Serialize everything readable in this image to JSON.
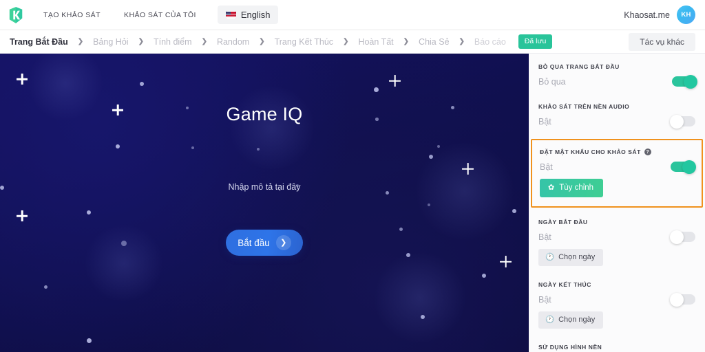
{
  "topbar": {
    "logo_alt": "khaosat-logo",
    "nav": [
      {
        "label": "TẠO KHẢO SÁT",
        "name": "nav-create-survey"
      },
      {
        "label": "KHẢO SÁT CỦA TÔI",
        "name": "nav-my-surveys"
      }
    ],
    "language": {
      "label": "English",
      "flag": "us-flag-icon"
    },
    "user": {
      "name": "Khaosat.me",
      "initials": "KH"
    }
  },
  "breadcrumb": {
    "items": [
      {
        "label": "Trang Bắt Đầu",
        "state": "active"
      },
      {
        "label": "Bảng Hỏi",
        "state": "inactive"
      },
      {
        "label": "Tính điểm",
        "state": "inactive"
      },
      {
        "label": "Random",
        "state": "inactive"
      },
      {
        "label": "Trang Kết Thúc",
        "state": "inactive"
      },
      {
        "label": "Hoàn Tất",
        "state": "inactive"
      },
      {
        "label": "Chia Sẻ",
        "state": "inactive"
      },
      {
        "label": "Báo cáo",
        "state": "dim"
      }
    ],
    "separator": "❯",
    "saved_badge": "Đã lưu",
    "more_actions": "Tác vụ khác"
  },
  "canvas": {
    "title": "Game IQ",
    "description": "Nhập mô tả tại đây",
    "start_button": "Bắt đầu",
    "start_chevron": "❯",
    "background_color": "#10104f"
  },
  "panel": {
    "sections": [
      {
        "name": "skip-start-page",
        "label": "BỎ QUA TRANG BẮT ĐẦU",
        "value": "Bỏ qua",
        "toggle": "on",
        "has_help": false,
        "highlighted": false,
        "button": null
      },
      {
        "name": "audio-background-survey",
        "label": "KHẢO SÁT TRÊN NỀN AUDIO",
        "value": "Bật",
        "toggle": "off",
        "has_help": false,
        "highlighted": false,
        "button": null
      },
      {
        "name": "survey-password",
        "label": "ĐẶT MẬT KHẨU CHO KHẢO SÁT",
        "value": "Bật",
        "toggle": "on",
        "has_help": true,
        "help_glyph": "?",
        "highlighted": true,
        "button": {
          "label": "Tùy chỉnh",
          "icon": "gear-icon",
          "glyph": "✿",
          "style": "green"
        }
      },
      {
        "name": "start-date",
        "label": "NGÀY BẮT ĐẦU",
        "value": "Bật",
        "toggle": "off",
        "has_help": false,
        "highlighted": false,
        "button": {
          "label": "Chọn ngày",
          "icon": "clock-icon",
          "glyph": "🕐",
          "style": "grey"
        }
      },
      {
        "name": "end-date",
        "label": "NGÀY KẾT THÚC",
        "value": "Bật",
        "toggle": "off",
        "has_help": false,
        "highlighted": false,
        "button": {
          "label": "Chọn ngày",
          "icon": "clock-icon",
          "glyph": "🕐",
          "style": "grey"
        }
      },
      {
        "name": "use-background-image",
        "label": "SỬ DỤNG HÌNH NỀN",
        "value": null,
        "toggle": null,
        "has_help": false,
        "highlighted": false,
        "button": null
      }
    ],
    "highlight_color": "#f0921d",
    "toggle_on_color": "#2ac49c"
  }
}
